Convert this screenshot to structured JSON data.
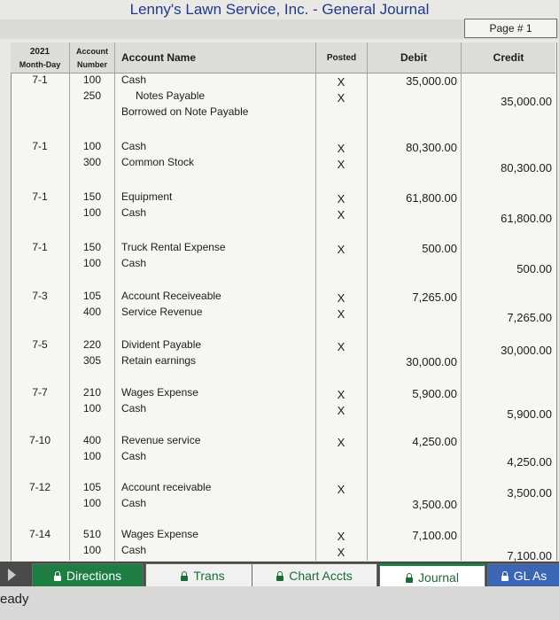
{
  "window": {
    "title": "Lenny's Lawn Service, Inc.  -  General Journal",
    "page_label": "Page # 1"
  },
  "header": {
    "year": "2021",
    "month_day": "Month-Day",
    "account": "Account",
    "number": "Number",
    "account_name": "Account Name",
    "posted": "Posted",
    "debit": "Debit",
    "credit": "Credit"
  },
  "entries": [
    {
      "date": "7-1",
      "lines": [
        {
          "acct": "100",
          "name": "Cash",
          "posted": "X",
          "debit": "35,000.00",
          "credit": ""
        },
        {
          "acct": "250",
          "name": "Notes Payable",
          "posted": "X",
          "debit": "",
          "credit": "35,000.00"
        },
        {
          "acct": "",
          "name": "Borrowed on Note Payable",
          "posted": "",
          "debit": "",
          "credit": ""
        }
      ]
    },
    {
      "date": "7-1",
      "lines": [
        {
          "acct": "100",
          "name": "Cash",
          "posted": "X",
          "debit": "80,300.00",
          "credit": ""
        },
        {
          "acct": "300",
          "name": "Common Stock",
          "posted": "X",
          "debit": "",
          "credit": "80,300.00"
        }
      ]
    },
    {
      "date": "7-1",
      "lines": [
        {
          "acct": "150",
          "name": "Equipment",
          "posted": "X",
          "debit": "61,800.00",
          "credit": ""
        },
        {
          "acct": "100",
          "name": "Cash",
          "posted": "X",
          "debit": "",
          "credit": "61,800.00"
        }
      ]
    },
    {
      "date": "7-1",
      "lines": [
        {
          "acct": "150",
          "name": "Truck Rental Expense",
          "posted": "X",
          "debit": "500.00",
          "credit": ""
        },
        {
          "acct": "100",
          "name": "Cash",
          "posted": "",
          "debit": "",
          "credit": "500.00"
        }
      ]
    },
    {
      "date": "7-3",
      "lines": [
        {
          "acct": "105",
          "name": "Account Receiveable",
          "posted": "X",
          "debit": "7,265.00",
          "credit": ""
        },
        {
          "acct": "400",
          "name": "Service Revenue",
          "posted": "X",
          "debit": "",
          "credit": "7,265.00"
        }
      ]
    },
    {
      "date": "7-5",
      "lines": [
        {
          "acct": "220",
          "name": "Divident Payable",
          "posted": "X",
          "debit": "",
          "credit": "30,000.00"
        },
        {
          "acct": "305",
          "name": "Retain earnings",
          "posted": "",
          "debit": "30,000.00",
          "credit": ""
        }
      ]
    },
    {
      "date": "7-7",
      "lines": [
        {
          "acct": "210",
          "name": "Wages Expense",
          "posted": "X",
          "debit": "5,900.00",
          "credit": ""
        },
        {
          "acct": "100",
          "name": "Cash",
          "posted": "X",
          "debit": "",
          "credit": "5,900.00"
        }
      ]
    },
    {
      "date": "7-10",
      "lines": [
        {
          "acct": "400",
          "name": "Revenue service",
          "posted": "X",
          "debit": "4,250.00",
          "credit": ""
        },
        {
          "acct": "100",
          "name": "Cash",
          "posted": "",
          "debit": "",
          "credit": "4,250.00"
        }
      ]
    },
    {
      "date": "7-12",
      "lines": [
        {
          "acct": "105",
          "name": "Account receivable",
          "posted": "X",
          "debit": "",
          "credit": "3,500.00"
        },
        {
          "acct": "100",
          "name": "Cash",
          "posted": "",
          "debit": "3,500.00",
          "credit": ""
        }
      ]
    },
    {
      "date": "7-14",
      "lines": [
        {
          "acct": "510",
          "name": "Wages Expense",
          "posted": "X",
          "debit": "7,100.00",
          "credit": ""
        },
        {
          "acct": "100",
          "name": "Cash",
          "posted": "X",
          "debit": "",
          "credit": "7,100.00"
        }
      ]
    }
  ],
  "tabs": [
    {
      "label": "Directions",
      "style": "green"
    },
    {
      "label": "Trans",
      "style": "light"
    },
    {
      "label": "Chart Accts",
      "style": "light"
    },
    {
      "label": "Journal",
      "style": "active"
    },
    {
      "label": "GL As",
      "style": "blue"
    }
  ],
  "status": {
    "text": "eady"
  },
  "colors": {
    "title": "#1f3a8a",
    "tab_green": "#1d7d42",
    "tab_blue": "#3b66b3"
  }
}
